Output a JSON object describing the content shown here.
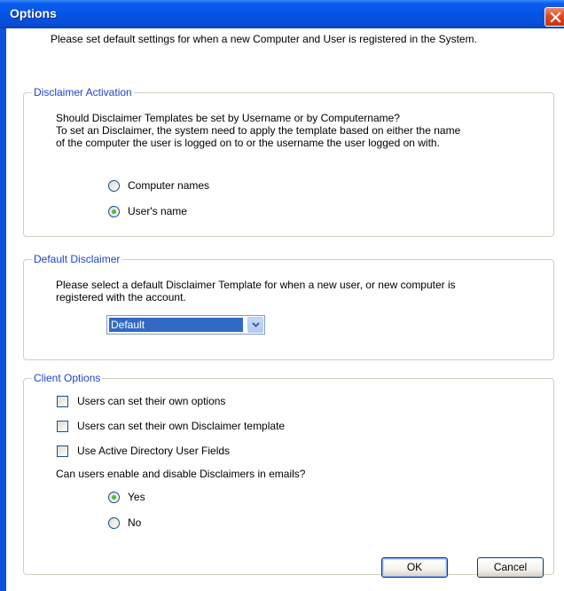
{
  "window": {
    "title": "Options"
  },
  "intro": "Please set default settings for when a new Computer and User is registered in the System.",
  "activation": {
    "legend": "Disclaimer Activation",
    "line1": "Should Disclaimer Templates be set by Username or by Computername?",
    "line2": "To set an Disclaimer, the system need to apply the template based on either the name",
    "line3": "of the computer the user is logged on to or the username the user logged on with.",
    "options": [
      {
        "label": "Computer names",
        "selected": false
      },
      {
        "label": "User's name",
        "selected": true
      }
    ]
  },
  "default_disclaimer": {
    "legend": "Default Disclaimer",
    "line1": "Please select a default Disclaimer Template for when a new user, or new computer is",
    "line2": "registered with the account.",
    "selected": "Default"
  },
  "client_options": {
    "legend": "Client Options",
    "checkboxes": [
      {
        "label": "Users can set their own options",
        "checked": false
      },
      {
        "label": "Users can set their own Disclaimer template",
        "checked": false
      },
      {
        "label": "Use Active Directory User Fields",
        "checked": false
      }
    ],
    "question": "Can users enable and disable Disclaimers in emails?",
    "options": [
      {
        "label": "Yes",
        "selected": true
      },
      {
        "label": "No",
        "selected": false
      }
    ]
  },
  "buttons": {
    "ok": "OK",
    "cancel": "Cancel"
  },
  "icons": {
    "close": "close-icon",
    "dropdown": "chevron-down-icon"
  }
}
